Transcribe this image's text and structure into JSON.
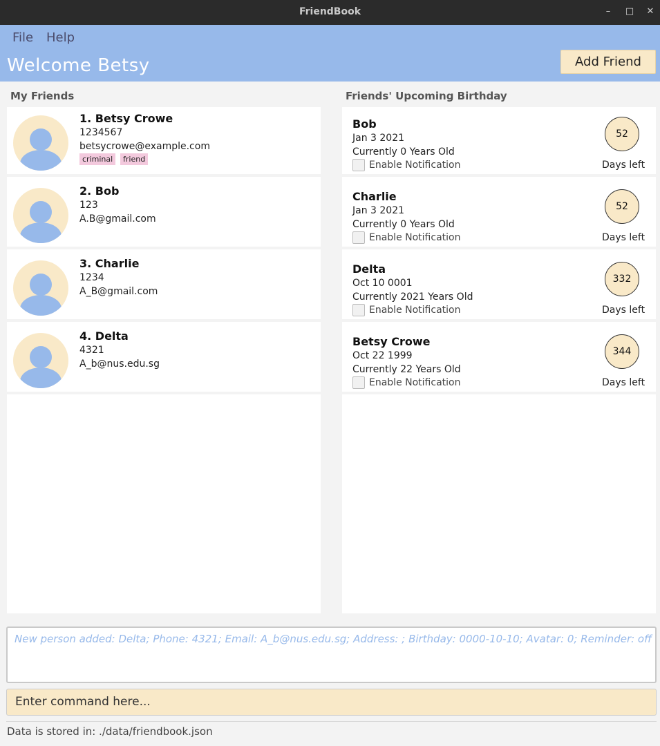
{
  "window": {
    "title": "FriendBook",
    "minimize": "–",
    "maximize": "□",
    "close": "✕"
  },
  "menu": {
    "file": "File",
    "help": "Help"
  },
  "header": {
    "welcome": "Welcome Betsy",
    "add_friend": "Add Friend"
  },
  "friends_section": {
    "title": "My Friends"
  },
  "friends": [
    {
      "name": "1. Betsy Crowe",
      "phone": "1234567",
      "email": "betsycrowe@example.com",
      "tags": [
        "criminal",
        "friend"
      ]
    },
    {
      "name": "2. Bob",
      "phone": "123",
      "email": "A.B@gmail.com",
      "tags": []
    },
    {
      "name": "3. Charlie",
      "phone": "1234",
      "email": "A_B@gmail.com",
      "tags": []
    },
    {
      "name": "4. Delta",
      "phone": "4321",
      "email": "A_b@nus.edu.sg",
      "tags": []
    }
  ],
  "birthday_section": {
    "title": "Friends' Upcoming Birthday"
  },
  "birthdays": [
    {
      "name": "Bob",
      "date": "Jan 3 2021",
      "age": "Currently 0 Years Old",
      "notification": "Enable Notification",
      "days": "52",
      "days_label": "Days left"
    },
    {
      "name": "Charlie",
      "date": "Jan 3 2021",
      "age": "Currently 0 Years Old",
      "notification": "Enable Notification",
      "days": "52",
      "days_label": "Days left"
    },
    {
      "name": "Delta",
      "date": "Oct 10 0001",
      "age": "Currently 2021 Years Old",
      "notification": "Enable Notification",
      "days": "332",
      "days_label": "Days left"
    },
    {
      "name": "Betsy Crowe",
      "date": "Oct 22 1999",
      "age": "Currently 22 Years Old",
      "notification": "Enable Notification",
      "days": "344",
      "days_label": "Days left"
    }
  ],
  "result": "New person added: Delta; Phone: 4321; Email: A_b@nus.edu.sg; Address: ; Birthday: 0000-10-10; Avatar: 0; Reminder: off",
  "command": {
    "placeholder": "Enter command here..."
  },
  "status": "Data is stored in: ./data/friendbook.json",
  "colors": {
    "header": "#97b9ea",
    "accent": "#f9e9c8",
    "tag": "#f3c9dd",
    "titlebar": "#2b2b2b"
  }
}
